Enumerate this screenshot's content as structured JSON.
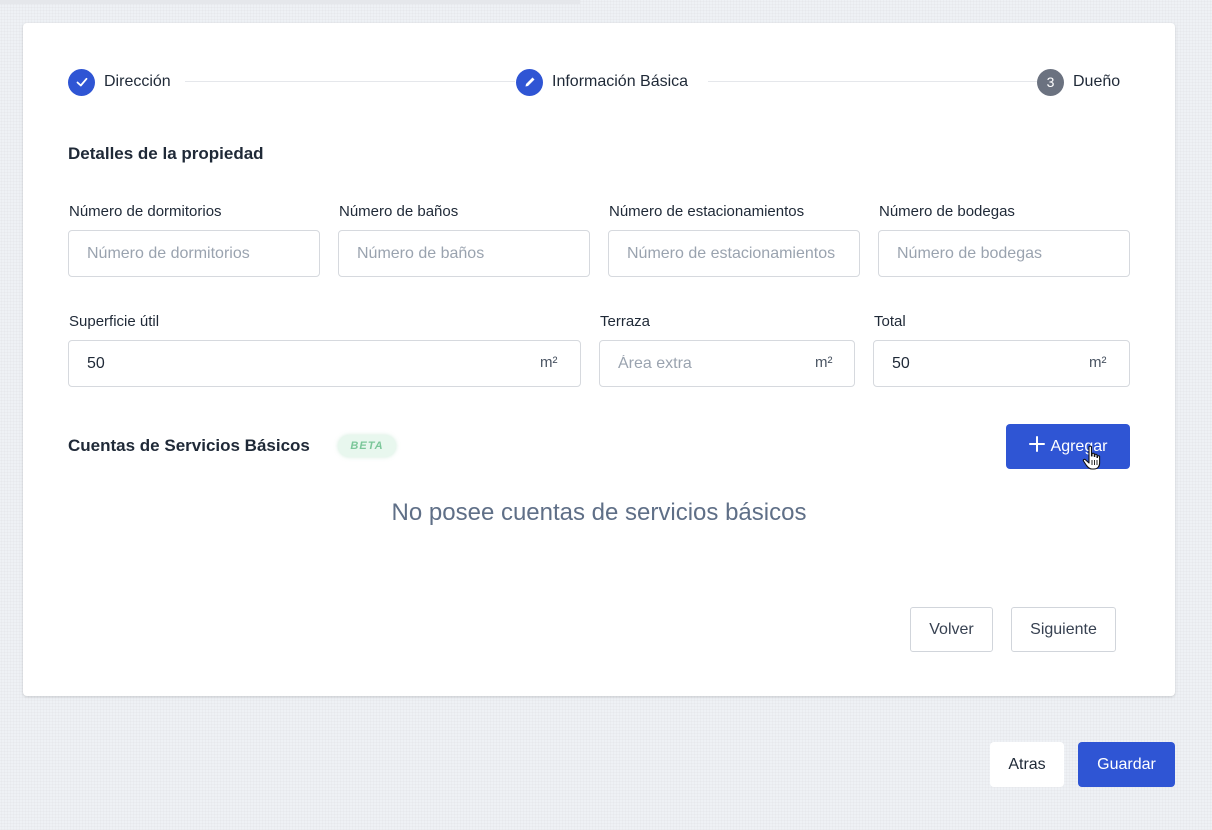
{
  "stepper": {
    "steps": [
      {
        "label": "Dirección",
        "state": "done",
        "marker": "✓"
      },
      {
        "label": "Información Básica",
        "state": "active",
        "marker": "✎"
      },
      {
        "label": "Dueño",
        "state": "pending",
        "marker": "3"
      }
    ]
  },
  "details": {
    "title": "Detalles de la propiedad",
    "bedrooms": {
      "label": "Número de dormitorios",
      "placeholder": "Número de dormitorios",
      "value": ""
    },
    "bathrooms": {
      "label": "Número de baños",
      "placeholder": "Número de baños",
      "value": ""
    },
    "parking": {
      "label": "Número de estacionamientos",
      "placeholder": "Número de estacionamientos",
      "value": ""
    },
    "storage": {
      "label": "Número de bodegas",
      "placeholder": "Número de bodegas",
      "value": ""
    },
    "usable_area": {
      "label": "Superficie útil",
      "placeholder": "",
      "value": "50",
      "unit": "m²"
    },
    "terrace": {
      "label": "Terraza",
      "placeholder": "Área extra",
      "value": "",
      "unit": "m²"
    },
    "total": {
      "label": "Total",
      "placeholder": "",
      "value": "50",
      "unit": "m²"
    }
  },
  "utilities": {
    "title": "Cuentas de Servicios Básicos",
    "badge": "BETA",
    "add_label": "Agregar",
    "empty_text": "No posee cuentas de servicios básicos"
  },
  "card_actions": {
    "back_label": "Volver",
    "next_label": "Siguiente"
  },
  "page_actions": {
    "back_label": "Atras",
    "save_label": "Guardar"
  },
  "colors": {
    "primary": "#2f55d4",
    "pending_step": "#6b7280",
    "beta_bg": "#e8f7ee",
    "beta_text": "#7cc79a"
  }
}
